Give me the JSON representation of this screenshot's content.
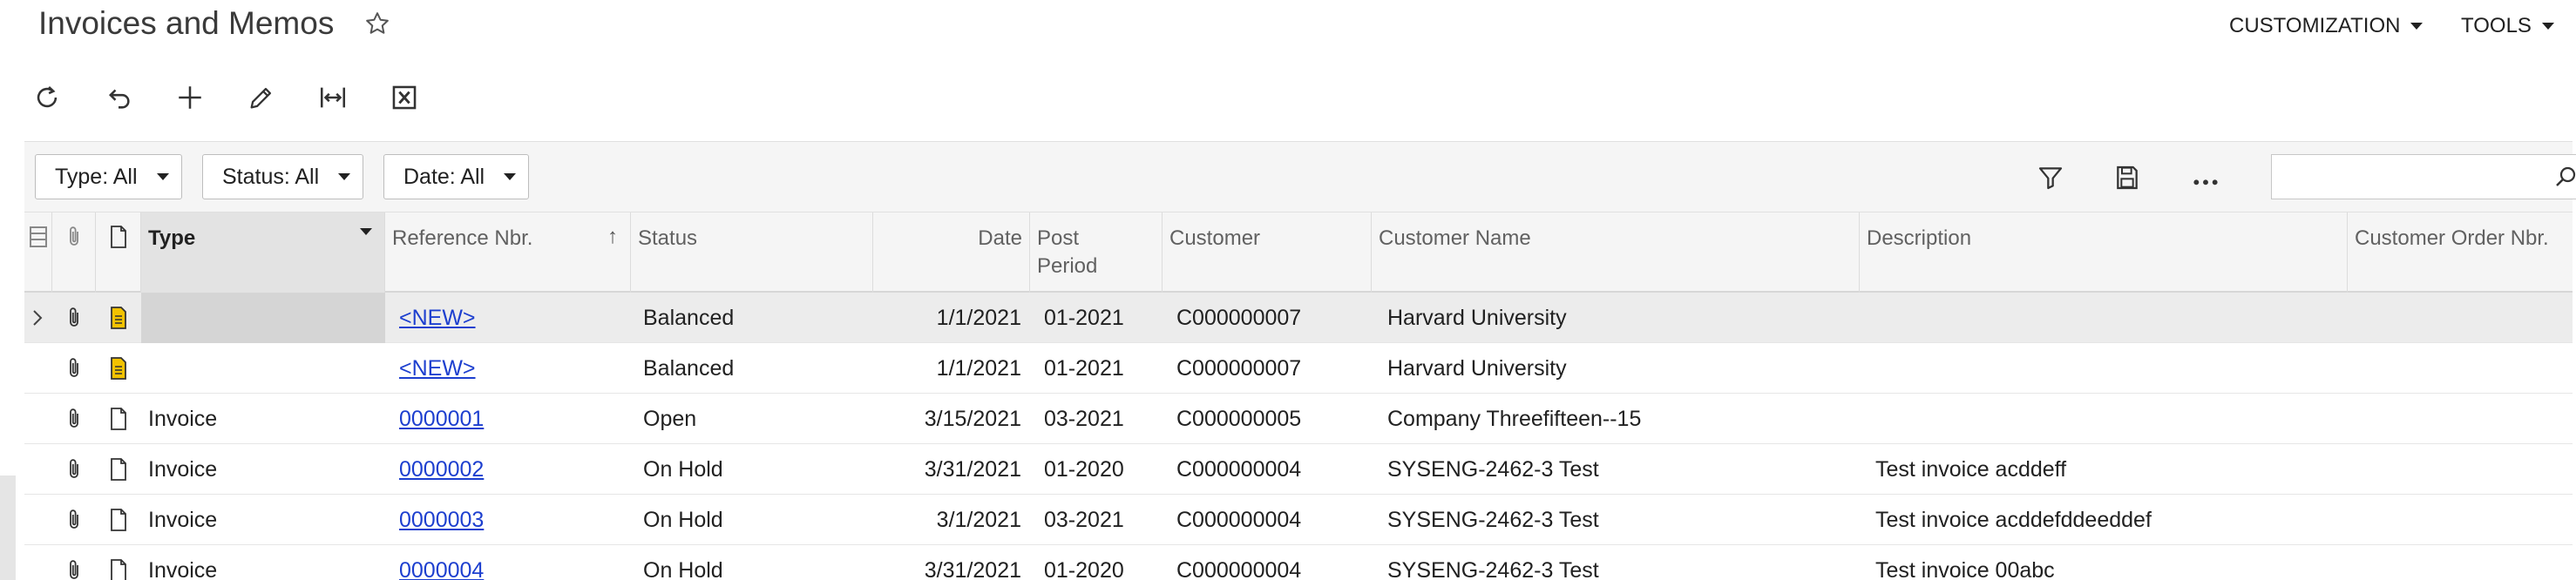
{
  "page": {
    "title": "Invoices and Memos"
  },
  "top_menu": {
    "customization": "CUSTOMIZATION",
    "tools": "TOOLS"
  },
  "toolbar": {
    "icons": [
      "refresh-icon",
      "undo-icon",
      "add-icon",
      "edit-icon",
      "fit-columns-icon",
      "export-excel-icon"
    ]
  },
  "filters": {
    "type": "Type: All",
    "status": "Status: All",
    "date": "Date: All"
  },
  "search": {
    "placeholder": ""
  },
  "grid": {
    "columns": {
      "type": "Type",
      "reference_nbr": "Reference Nbr.",
      "status": "Status",
      "date": "Date",
      "post_period_line1": "Post",
      "post_period_line2": "Period",
      "customer": "Customer",
      "customer_name": "Customer Name",
      "description": "Description",
      "customer_order_nbr": "Customer Order Nbr."
    },
    "sort_indicator": "↑",
    "rows": [
      {
        "type": "",
        "ref": "<NEW>",
        "status": "Balanced",
        "date": "1/1/2021",
        "period": "01-2021",
        "customer": "C000000007",
        "customer_name": "Harvard University",
        "description": ""
      },
      {
        "type": "",
        "ref": "<NEW>",
        "status": "Balanced",
        "date": "1/1/2021",
        "period": "01-2021",
        "customer": "C000000007",
        "customer_name": "Harvard University",
        "description": ""
      },
      {
        "type": "Invoice",
        "ref": "0000001",
        "status": "Open",
        "date": "3/15/2021",
        "period": "03-2021",
        "customer": "C000000005",
        "customer_name": "Company Threefifteen--15",
        "description": ""
      },
      {
        "type": "Invoice",
        "ref": "0000002",
        "status": "On Hold",
        "date": "3/31/2021",
        "period": "01-2020",
        "customer": "C000000004",
        "customer_name": "SYSENG-2462-3 Test",
        "description": "Test invoice acddeff"
      },
      {
        "type": "Invoice",
        "ref": "0000003",
        "status": "On Hold",
        "date": "3/1/2021",
        "period": "03-2021",
        "customer": "C000000004",
        "customer_name": "SYSENG-2462-3 Test",
        "description": "Test invoice acddefddeeddef"
      },
      {
        "type": "Invoice",
        "ref": "0000004",
        "status": "On Hold",
        "date": "3/31/2021",
        "period": "01-2020",
        "customer": "C000000004",
        "customer_name": "SYSENG-2462-3 Test",
        "description": "Test invoice 00abc"
      }
    ]
  },
  "colors": {
    "link": "#1d3fcf",
    "note_yellow": "#f2c200"
  }
}
